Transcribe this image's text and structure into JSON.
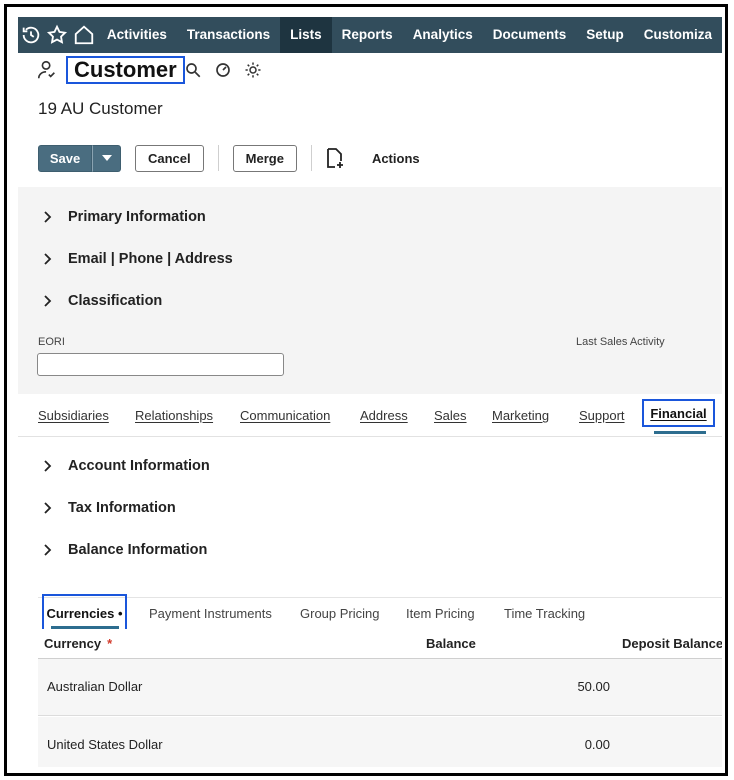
{
  "nav": {
    "items": [
      {
        "label": "Activities",
        "active": false
      },
      {
        "label": "Transactions",
        "active": false
      },
      {
        "label": "Lists",
        "active": true
      },
      {
        "label": "Reports",
        "active": false
      },
      {
        "label": "Analytics",
        "active": false
      },
      {
        "label": "Documents",
        "active": false
      },
      {
        "label": "Setup",
        "active": false
      },
      {
        "label": "Customiza",
        "active": false
      }
    ],
    "icons": [
      "recent-records-icon",
      "star-icon",
      "home-icon"
    ]
  },
  "header": {
    "title": "Customer",
    "record_name": "19 AU Customer",
    "icons": [
      "customer-record-icon",
      "search-icon",
      "dashboard-gauge-icon",
      "sun-icon"
    ]
  },
  "toolbar": {
    "save_label": "Save",
    "cancel_label": "Cancel",
    "merge_label": "Merge",
    "actions_label": "Actions"
  },
  "sections": {
    "primary": "Primary Information",
    "contact": "Email | Phone | Address",
    "classification": "Classification"
  },
  "fields": {
    "eori_label": "EORI",
    "eori_value": "",
    "last_sales_label": "Last Sales Activity"
  },
  "subtabs": [
    {
      "label": "Subsidiaries"
    },
    {
      "label": "Relationships"
    },
    {
      "label": "Communication"
    },
    {
      "label": "Address"
    },
    {
      "label": "Sales"
    },
    {
      "label": "Marketing"
    },
    {
      "label": "Support"
    },
    {
      "label": "Financial"
    }
  ],
  "financial_sections": {
    "account": "Account Information",
    "tax": "Tax Information",
    "balance": "Balance Information"
  },
  "inner_tabs": {
    "active": "Currencies •",
    "others": [
      "Payment Instruments",
      "Group Pricing",
      "Item Pricing",
      "Time Tracking"
    ]
  },
  "grid": {
    "headers": {
      "currency": "Currency",
      "required_mark": "*",
      "balance": "Balance",
      "deposit_balance": "Deposit Balance"
    },
    "rows": [
      {
        "currency": "Australian Dollar",
        "balance": "50.00"
      },
      {
        "currency": "United States Dollar",
        "balance": "0.00"
      }
    ]
  },
  "colors": {
    "nav_bg": "#324d5c",
    "nav_active_bg": "#1e3440",
    "primary_button": "#4a6d80",
    "highlight_outline": "#1a56db",
    "tab_underline": "#2d6d8f",
    "required": "#d23a2b"
  }
}
